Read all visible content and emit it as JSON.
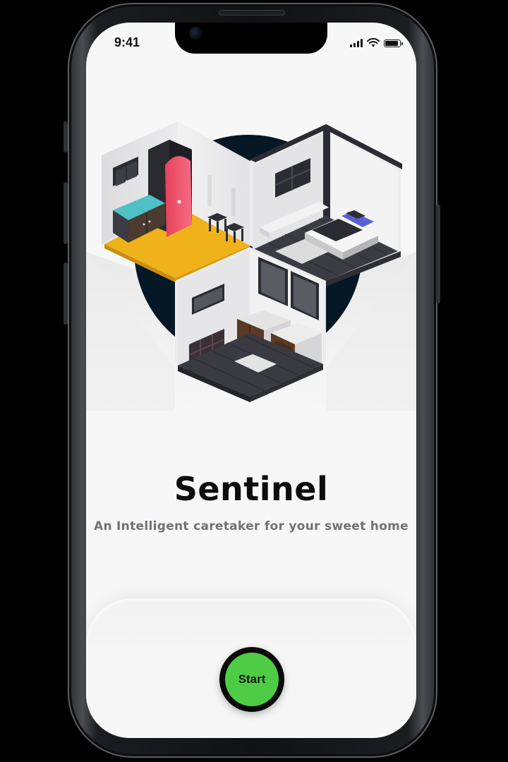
{
  "status_bar": {
    "time": "9:41",
    "icons": [
      "signal-icon",
      "wifi-icon",
      "battery-icon"
    ]
  },
  "hero": {
    "illustration": "isometric-house-rooms-illustration",
    "backdrop_color": "#061826"
  },
  "app": {
    "title": "Sentinel",
    "subtitle": "An Intelligent caretaker for your sweet home"
  },
  "actions": {
    "start_label": "Start",
    "start_color": "#4fcc46"
  }
}
